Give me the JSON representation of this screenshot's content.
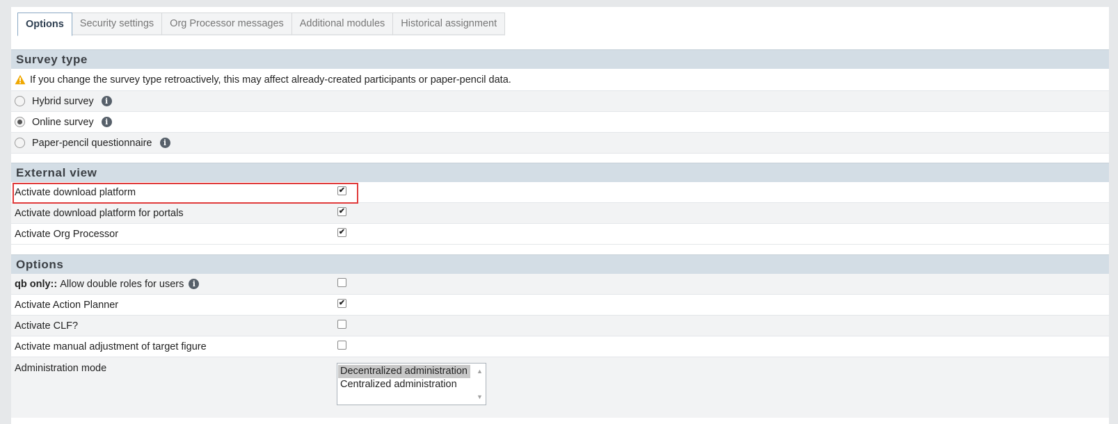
{
  "tabs": [
    {
      "label": "Options",
      "active": true
    },
    {
      "label": "Security settings"
    },
    {
      "label": "Org Processor messages"
    },
    {
      "label": "Additional modules"
    },
    {
      "label": "Historical assignment"
    }
  ],
  "survey_type": {
    "title": "Survey type",
    "warning": "If you change the survey type retroactively, this may affect already-created participants or paper-pencil data.",
    "options": [
      {
        "label": "Hybrid survey",
        "selected": false
      },
      {
        "label": "Online survey",
        "selected": true
      },
      {
        "label": "Paper-pencil questionnaire",
        "selected": false
      }
    ]
  },
  "external_view": {
    "title": "External view",
    "rows": [
      {
        "label": "Activate download platform",
        "checked": true
      },
      {
        "label": "Activate download platform for portals",
        "checked": true
      },
      {
        "label": "Activate Org Processor",
        "checked": true
      }
    ]
  },
  "options": {
    "title": "Options",
    "double_roles": {
      "prefix": "qb only::",
      "label": "Allow double roles for users",
      "checked": false
    },
    "rows": [
      {
        "label": "Activate Action Planner",
        "checked": true
      },
      {
        "label": "Activate CLF?",
        "checked": false
      },
      {
        "label": "Activate manual adjustment of target figure",
        "checked": false
      }
    ],
    "admin_mode": {
      "label": "Administration mode",
      "options": [
        "Decentralized administration",
        "Centralized administration"
      ],
      "selected": "Decentralized administration"
    }
  },
  "icons": {
    "info": "i",
    "check": "✔",
    "scroll_up": "▲",
    "scroll_down": "▼"
  },
  "colors": {
    "highlight": "#e03a3a",
    "warning": "#f0a800",
    "section_bg": "#d3dde5"
  }
}
